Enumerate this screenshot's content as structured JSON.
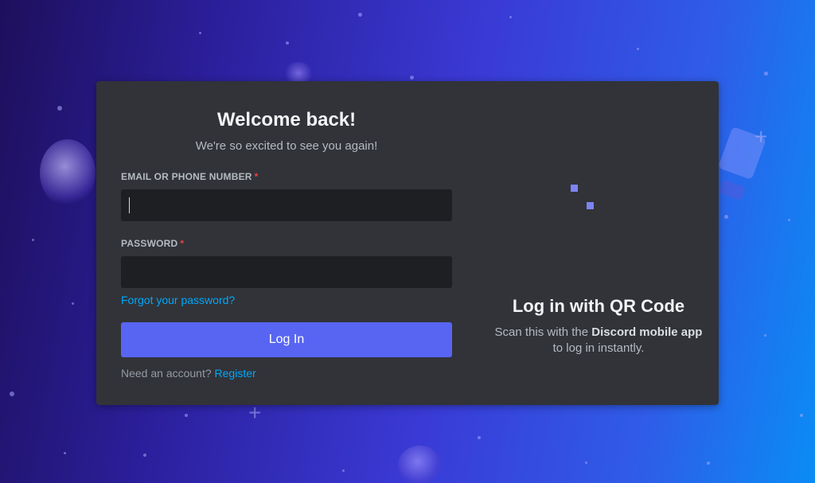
{
  "colors": {
    "card_bg": "#313338",
    "input_bg": "#1e1f22",
    "accent": "#5865f2",
    "link": "#00a8fc",
    "required": "#f23f43"
  },
  "login": {
    "title": "Welcome back!",
    "subtitle": "We're so excited to see you again!",
    "email_label": "EMAIL OR PHONE NUMBER",
    "email_value": "",
    "password_label": "PASSWORD",
    "password_value": "",
    "required_mark": "*",
    "forgot_link": "Forgot your password?",
    "login_button": "Log In",
    "need_account_text": "Need an account?",
    "register_link": "Register"
  },
  "qr": {
    "title": "Log in with QR Code",
    "desc_prefix": "Scan this with the ",
    "desc_bold": "Discord mobile app",
    "desc_suffix": " to log in instantly."
  }
}
